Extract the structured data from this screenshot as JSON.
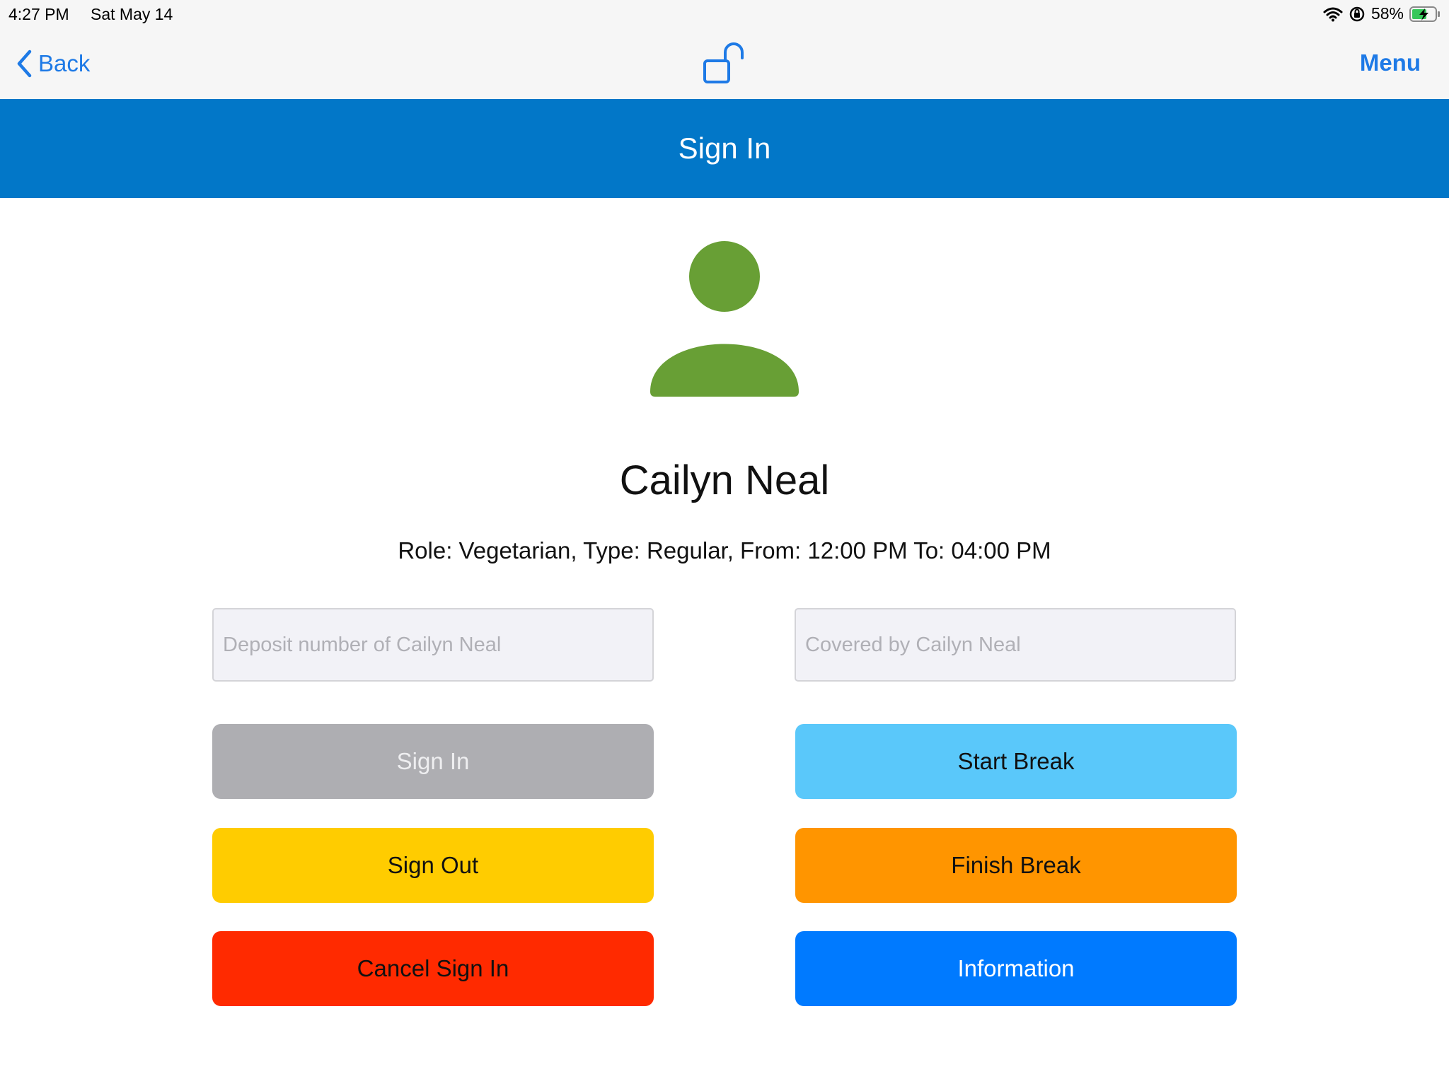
{
  "status_bar": {
    "time": "4:27 PM",
    "date": "Sat May 14",
    "battery_percent": "58%",
    "icons": [
      "wifi-icon",
      "orientation-lock-icon",
      "battery-charging-icon"
    ]
  },
  "nav": {
    "back_label": "Back",
    "center_icon": "unlocked-padlock-icon",
    "menu_label": "Menu"
  },
  "header": {
    "title": "Sign In"
  },
  "profile": {
    "avatar_icon": "person-icon",
    "name": "Cailyn Neal",
    "info": "Role: Vegetarian, Type: Regular, From: 12:00 PM To: 04:00 PM"
  },
  "fields": {
    "deposit_placeholder": "Deposit number of Cailyn Neal",
    "covered_placeholder": "Covered by Cailyn Neal"
  },
  "buttons": {
    "sign_in": "Sign In",
    "start_break": "Start Break",
    "sign_out": "Sign Out",
    "finish_break": "Finish Break",
    "cancel_sign_in": "Cancel Sign In",
    "information": "Information"
  },
  "colors": {
    "accent": "#1e7ae6",
    "header": "#0277c8",
    "avatar": "#689f35",
    "sign_in_disabled": "#aeaeb2",
    "start_break": "#5ac8fa",
    "sign_out": "#ffcc00",
    "finish_break": "#ff9500",
    "cancel_sign_in": "#ff2a00",
    "information": "#007aff"
  }
}
